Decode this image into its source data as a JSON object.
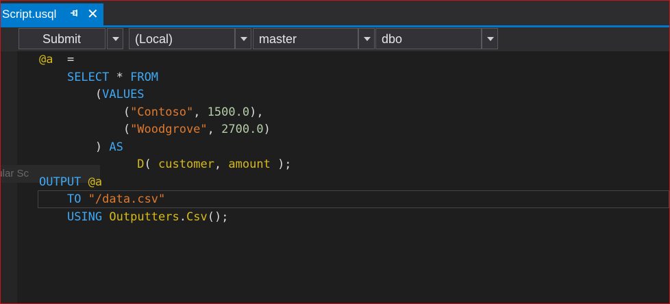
{
  "tab": {
    "title": "Script.usql",
    "pin_glyph": "⊣",
    "close_glyph": "✕"
  },
  "toolbar": {
    "submit_label": "Submit",
    "server_value": "(Local)",
    "database_value": "master",
    "schema_value": "dbo"
  },
  "editor": {
    "ghost_label": "gular Sc",
    "lines": [
      [
        {
          "t": "@a",
          "c": "var"
        },
        {
          "t": "  =",
          "c": "op"
        }
      ],
      [
        {
          "t": "    ",
          "c": "op"
        },
        {
          "t": "SELECT",
          "c": "kw"
        },
        {
          "t": " * ",
          "c": "op"
        },
        {
          "t": "FROM",
          "c": "kw"
        }
      ],
      [
        {
          "t": "        (",
          "c": "op"
        },
        {
          "t": "VALUES",
          "c": "kw"
        }
      ],
      [
        {
          "t": "            (",
          "c": "op"
        },
        {
          "t": "\"Contoso\"",
          "c": "str"
        },
        {
          "t": ", ",
          "c": "op"
        },
        {
          "t": "1500.0",
          "c": "num"
        },
        {
          "t": "),",
          "c": "op"
        }
      ],
      [
        {
          "t": "            (",
          "c": "op"
        },
        {
          "t": "\"Woodgrove\"",
          "c": "str"
        },
        {
          "t": ", ",
          "c": "op"
        },
        {
          "t": "2700.0",
          "c": "num"
        },
        {
          "t": ")",
          "c": "op"
        }
      ],
      [
        {
          "t": "        ) ",
          "c": "op"
        },
        {
          "t": "AS",
          "c": "kw"
        }
      ],
      [
        {
          "t": "              ",
          "c": "op"
        },
        {
          "t": "D",
          "c": "id"
        },
        {
          "t": "( ",
          "c": "op"
        },
        {
          "t": "customer",
          "c": "id"
        },
        {
          "t": ", ",
          "c": "op"
        },
        {
          "t": "amount",
          "c": "id"
        },
        {
          "t": " );",
          "c": "op"
        }
      ],
      [
        {
          "t": "OUTPUT",
          "c": "kw"
        },
        {
          "t": " ",
          "c": "op"
        },
        {
          "t": "@a",
          "c": "var"
        }
      ],
      [
        {
          "t": "    ",
          "c": "op"
        },
        {
          "t": "TO",
          "c": "kw"
        },
        {
          "t": " ",
          "c": "op"
        },
        {
          "t": "\"/data.csv\"",
          "c": "str"
        }
      ],
      [
        {
          "t": "    ",
          "c": "op"
        },
        {
          "t": "USING",
          "c": "kw"
        },
        {
          "t": " ",
          "c": "op"
        },
        {
          "t": "Outputters",
          "c": "id"
        },
        {
          "t": ".",
          "c": "op"
        },
        {
          "t": "Csv",
          "c": "id"
        },
        {
          "t": "();",
          "c": "op"
        }
      ]
    ]
  }
}
